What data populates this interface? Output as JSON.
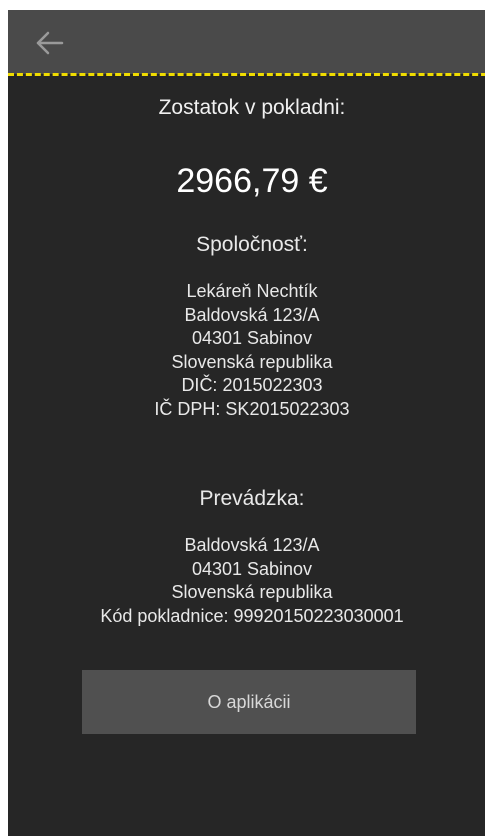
{
  "header": {
    "back_icon": "arrow-left-icon",
    "accent_color": "#f0dc00"
  },
  "balance": {
    "label": "Zostatok v pokladni:",
    "value": "2966,79 €"
  },
  "company": {
    "title": "Spoločnosť:",
    "lines": [
      "Lekáreň Nechtík",
      "Baldovská 123/A",
      "04301 Sabinov",
      "Slovenská republika",
      "DIČ: 2015022303",
      "IČ DPH: SK2015022303"
    ]
  },
  "shop": {
    "title": "Prevádzka:",
    "lines": [
      "Baldovská 123/A",
      "04301 Sabinov",
      "Slovenská republika",
      "Kód pokladnice: 99920150223030001"
    ]
  },
  "about_button": {
    "label": "O aplikácii"
  }
}
